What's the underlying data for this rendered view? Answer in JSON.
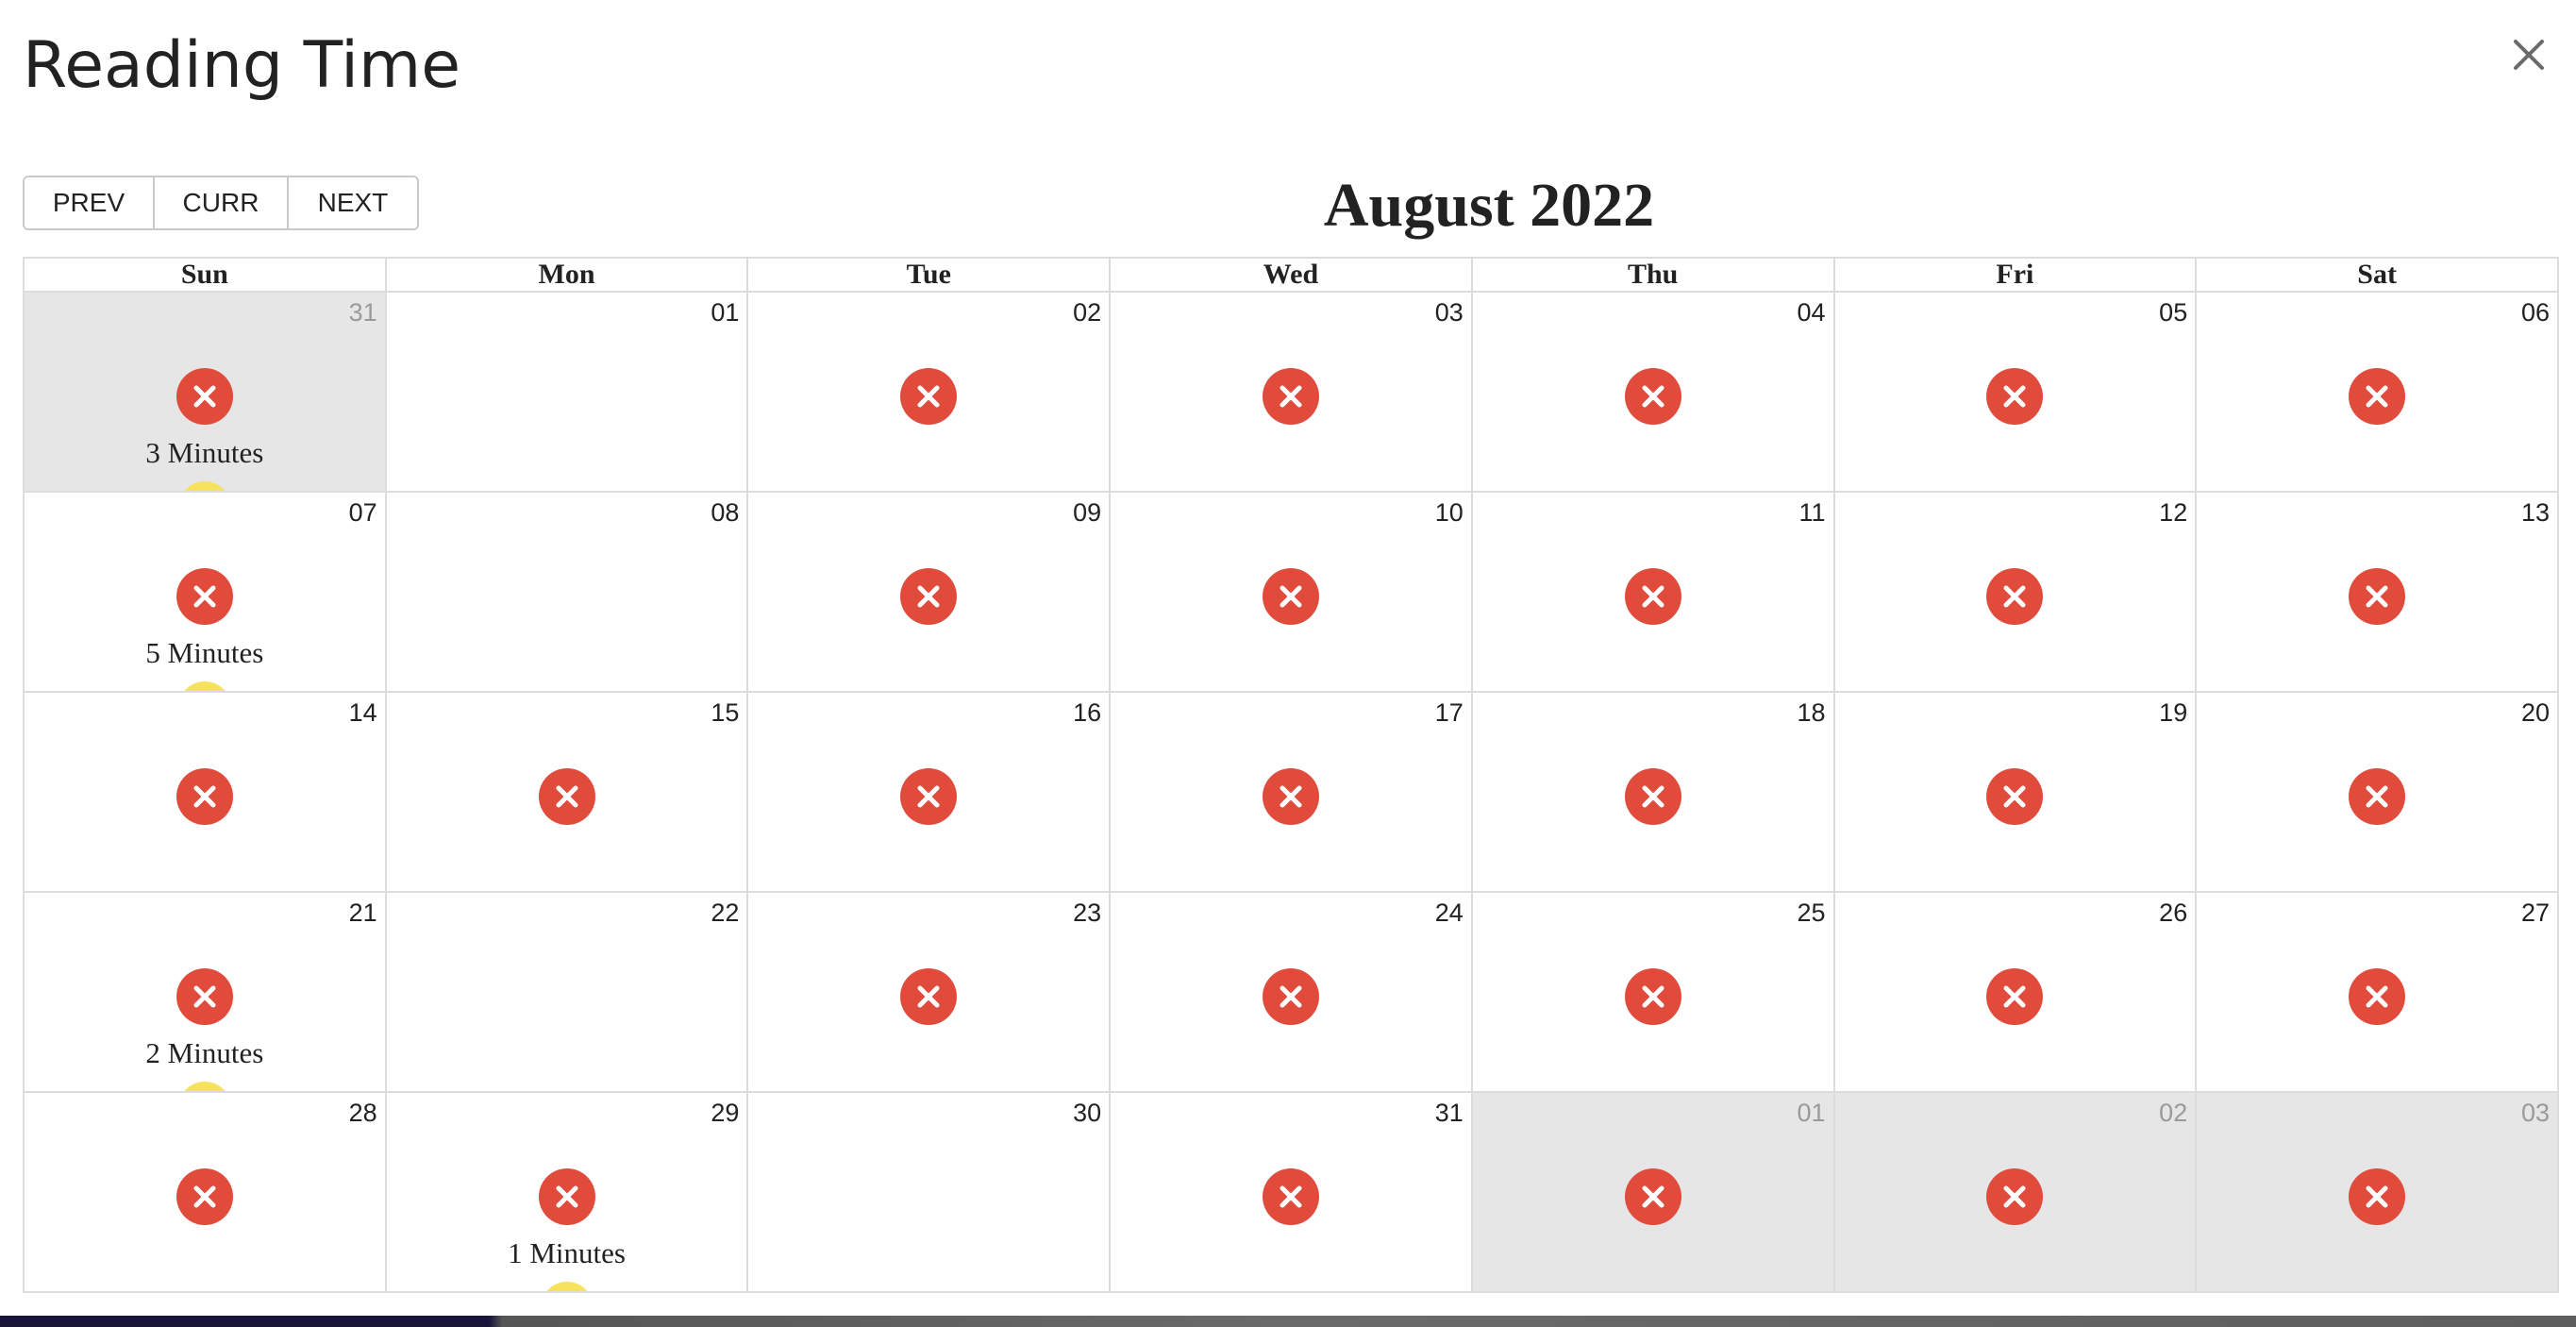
{
  "header": {
    "title": "Reading Time",
    "close_icon": "close-icon"
  },
  "nav": {
    "prev_label": "PREV",
    "curr_label": "CURR",
    "next_label": "NEXT"
  },
  "calendar": {
    "month_title": "August 2022",
    "weekdays": [
      "Sun",
      "Mon",
      "Tue",
      "Wed",
      "Thu",
      "Fri",
      "Sat"
    ],
    "colors": {
      "missed": "#e04b3b",
      "read": "#f7e25e",
      "other_month_bg": "#e6e6e6"
    },
    "weeks": [
      [
        {
          "day": "31",
          "other": true,
          "missed": true,
          "minutes": "3 Minutes"
        },
        {
          "day": "01",
          "other": false,
          "missed": false,
          "minutes": ""
        },
        {
          "day": "02",
          "other": false,
          "missed": true,
          "minutes": ""
        },
        {
          "day": "03",
          "other": false,
          "missed": true,
          "minutes": ""
        },
        {
          "day": "04",
          "other": false,
          "missed": true,
          "minutes": ""
        },
        {
          "day": "05",
          "other": false,
          "missed": true,
          "minutes": ""
        },
        {
          "day": "06",
          "other": false,
          "missed": true,
          "minutes": ""
        }
      ],
      [
        {
          "day": "07",
          "other": false,
          "missed": true,
          "minutes": "5 Minutes"
        },
        {
          "day": "08",
          "other": false,
          "missed": false,
          "minutes": ""
        },
        {
          "day": "09",
          "other": false,
          "missed": true,
          "minutes": ""
        },
        {
          "day": "10",
          "other": false,
          "missed": true,
          "minutes": ""
        },
        {
          "day": "11",
          "other": false,
          "missed": true,
          "minutes": ""
        },
        {
          "day": "12",
          "other": false,
          "missed": true,
          "minutes": ""
        },
        {
          "day": "13",
          "other": false,
          "missed": true,
          "minutes": ""
        }
      ],
      [
        {
          "day": "14",
          "other": false,
          "missed": true,
          "minutes": ""
        },
        {
          "day": "15",
          "other": false,
          "missed": true,
          "minutes": ""
        },
        {
          "day": "16",
          "other": false,
          "missed": true,
          "minutes": ""
        },
        {
          "day": "17",
          "other": false,
          "missed": true,
          "minutes": ""
        },
        {
          "day": "18",
          "other": false,
          "missed": true,
          "minutes": ""
        },
        {
          "day": "19",
          "other": false,
          "missed": true,
          "minutes": ""
        },
        {
          "day": "20",
          "other": false,
          "missed": true,
          "minutes": ""
        }
      ],
      [
        {
          "day": "21",
          "other": false,
          "missed": true,
          "minutes": "2 Minutes"
        },
        {
          "day": "22",
          "other": false,
          "missed": false,
          "minutes": ""
        },
        {
          "day": "23",
          "other": false,
          "missed": true,
          "minutes": ""
        },
        {
          "day": "24",
          "other": false,
          "missed": true,
          "minutes": ""
        },
        {
          "day": "25",
          "other": false,
          "missed": true,
          "minutes": ""
        },
        {
          "day": "26",
          "other": false,
          "missed": true,
          "minutes": ""
        },
        {
          "day": "27",
          "other": false,
          "missed": true,
          "minutes": ""
        }
      ],
      [
        {
          "day": "28",
          "other": false,
          "missed": true,
          "minutes": ""
        },
        {
          "day": "29",
          "other": false,
          "missed": true,
          "minutes": "1 Minutes"
        },
        {
          "day": "30",
          "other": false,
          "missed": false,
          "minutes": ""
        },
        {
          "day": "31",
          "other": false,
          "missed": true,
          "minutes": ""
        },
        {
          "day": "01",
          "other": true,
          "missed": true,
          "minutes": ""
        },
        {
          "day": "02",
          "other": true,
          "missed": true,
          "minutes": ""
        },
        {
          "day": "03",
          "other": true,
          "missed": true,
          "minutes": ""
        }
      ]
    ]
  }
}
